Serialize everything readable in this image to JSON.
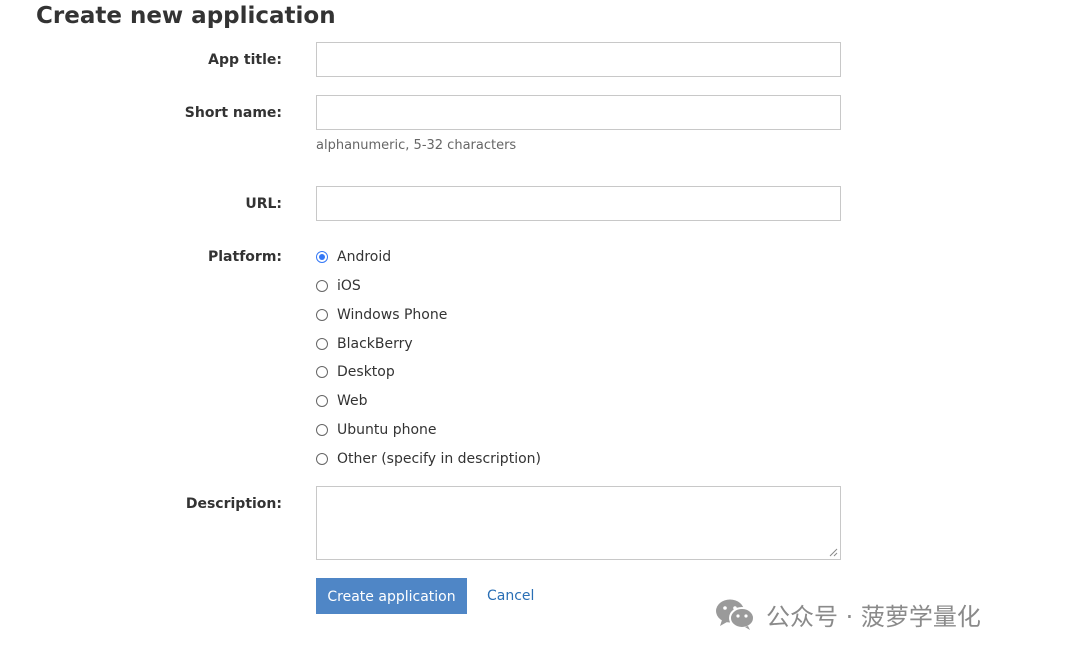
{
  "page": {
    "title": "Create new application"
  },
  "form": {
    "app_title": {
      "label": "App title:",
      "value": "",
      "placeholder": ""
    },
    "short_name": {
      "label": "Short name:",
      "value": "",
      "placeholder": "",
      "hint": "alphanumeric, 5-32 characters"
    },
    "url": {
      "label": "URL:",
      "value": "",
      "placeholder": ""
    },
    "platform": {
      "label": "Platform:",
      "selected": "Android",
      "options": [
        "Android",
        "iOS",
        "Windows Phone",
        "BlackBerry",
        "Desktop",
        "Web",
        "Ubuntu phone",
        "Other (specify in description)"
      ]
    },
    "description": {
      "label": "Description:",
      "value": ""
    }
  },
  "actions": {
    "create_label": "Create application",
    "cancel_label": "Cancel"
  },
  "watermark": {
    "text": "公众号 · 菠萝学量化",
    "icon": "wechat-icon"
  },
  "colors": {
    "accent": "#4f86c6",
    "link": "#2a6fb5",
    "radio_selected": "#3478f6"
  }
}
